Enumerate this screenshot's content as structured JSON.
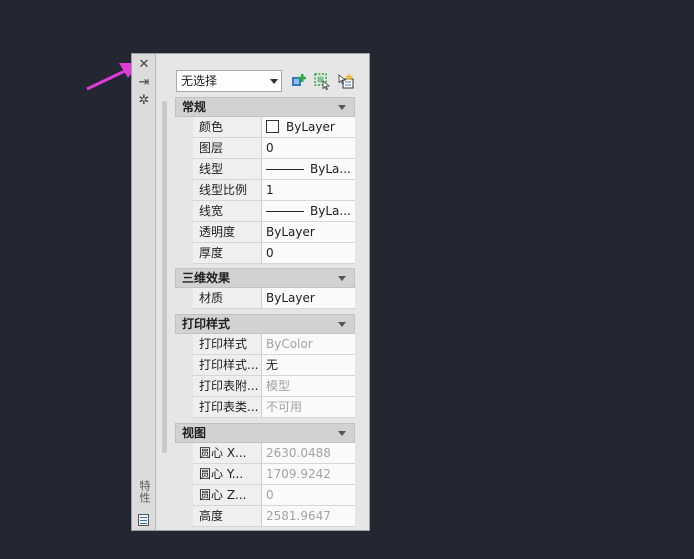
{
  "panel": {
    "title": "特性",
    "close_glyph": "✕",
    "autohide_glyph": "⇥",
    "settings_glyph": "✲"
  },
  "toolbar": {
    "selection_value": "无选择"
  },
  "sections": {
    "general": {
      "title": "常规",
      "rows": [
        {
          "name": "颜色",
          "value": "ByLayer"
        },
        {
          "name": "图层",
          "value": "0"
        },
        {
          "name": "线型",
          "value": "ByLa..."
        },
        {
          "name": "线型比例",
          "value": "1"
        },
        {
          "name": "线宽",
          "value": "ByLa..."
        },
        {
          "name": "透明度",
          "value": "ByLayer"
        },
        {
          "name": "厚度",
          "value": "0"
        }
      ]
    },
    "3d": {
      "title": "三维效果",
      "rows": [
        {
          "name": "材质",
          "value": "ByLayer"
        }
      ]
    },
    "plot": {
      "title": "打印样式",
      "rows": [
        {
          "name": "打印样式",
          "value": "ByColor"
        },
        {
          "name": "打印样式...",
          "value": "无"
        },
        {
          "name": "打印表附...",
          "value": "模型"
        },
        {
          "name": "打印表类...",
          "value": "不可用"
        }
      ]
    },
    "view": {
      "title": "视图",
      "rows": [
        {
          "name": "圆心 X...",
          "value": "2630.0488"
        },
        {
          "name": "圆心 Y...",
          "value": "1709.9242"
        },
        {
          "name": "圆心 Z...",
          "value": "0"
        },
        {
          "name": "高度",
          "value": "2581.9647"
        }
      ]
    }
  },
  "colors": {
    "background": "#222731",
    "arrow": "#e03ad8",
    "panel": "#e6e6e6"
  }
}
